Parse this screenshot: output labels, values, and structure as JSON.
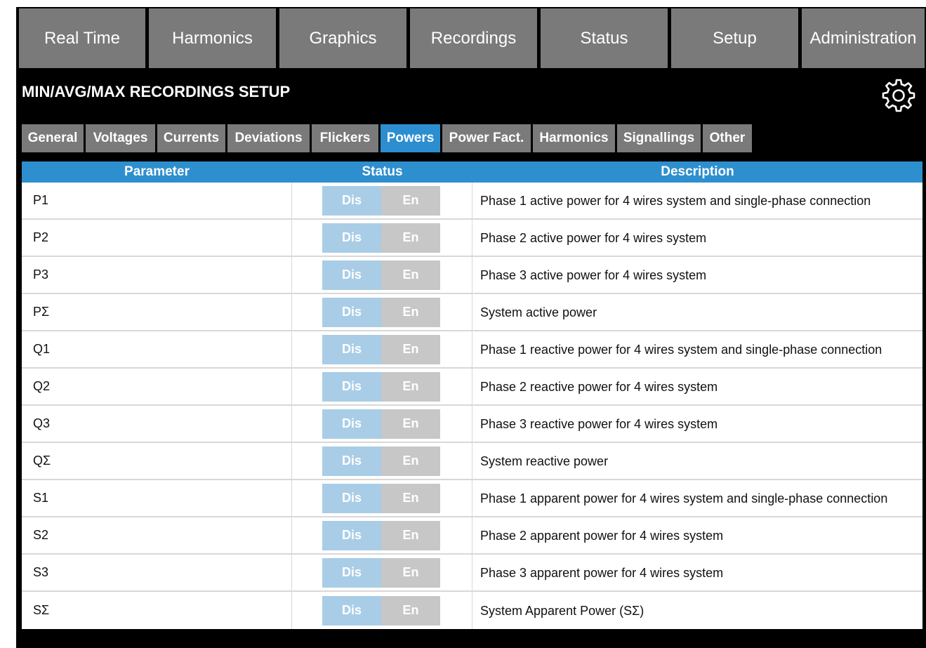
{
  "nav": {
    "items": [
      {
        "label": "Real Time"
      },
      {
        "label": "Harmonics"
      },
      {
        "label": "Graphics"
      },
      {
        "label": "Recordings"
      },
      {
        "label": "Status"
      },
      {
        "label": "Setup"
      },
      {
        "label": "Administration"
      }
    ]
  },
  "page": {
    "title": "MIN/AVG/MAX RECORDINGS SETUP",
    "settings_icon": "gear-icon"
  },
  "tabs": {
    "active": "Powers",
    "items": [
      {
        "label": "General"
      },
      {
        "label": "Voltages"
      },
      {
        "label": "Currents"
      },
      {
        "label": "Deviations"
      },
      {
        "label": "Flickers"
      },
      {
        "label": "Powers"
      },
      {
        "label": "Power Fact."
      },
      {
        "label": "Harmonics"
      },
      {
        "label": "Signallings"
      },
      {
        "label": "Other"
      }
    ]
  },
  "table": {
    "headers": {
      "parameter": "Parameter",
      "status": "Status",
      "description": "Description"
    },
    "toggle": {
      "dis": "Dis",
      "en": "En"
    },
    "rows": [
      {
        "param": "P1",
        "desc": "Phase 1 active power for 4 wires system and single-phase connection"
      },
      {
        "param": "P2",
        "desc": "Phase 2 active power for 4 wires system"
      },
      {
        "param": "P3",
        "desc": "Phase 3 active power for 4 wires system"
      },
      {
        "param": "PΣ",
        "desc": "System active power"
      },
      {
        "param": "Q1",
        "desc": "Phase 1 reactive power for 4 wires system and single-phase connection"
      },
      {
        "param": "Q2",
        "desc": "Phase 2 reactive power for 4 wires system"
      },
      {
        "param": "Q3",
        "desc": "Phase 3 reactive power for 4 wires system"
      },
      {
        "param": "QΣ",
        "desc": "System reactive power"
      },
      {
        "param": "S1",
        "desc": "Phase 1 apparent power for 4 wires system and single-phase connection"
      },
      {
        "param": "S2",
        "desc": "Phase 2 apparent power for 4 wires system"
      },
      {
        "param": "S3",
        "desc": "Phase 3 apparent power for 4 wires system"
      },
      {
        "param": "SΣ",
        "desc": "System Apparent Power (SΣ)"
      }
    ]
  },
  "colors": {
    "background": "#000000",
    "nav_bg": "#7a7a7a",
    "accent": "#2c8ed0",
    "toggle_dis": "#a9cde6",
    "toggle_en": "#c7c7c7"
  }
}
